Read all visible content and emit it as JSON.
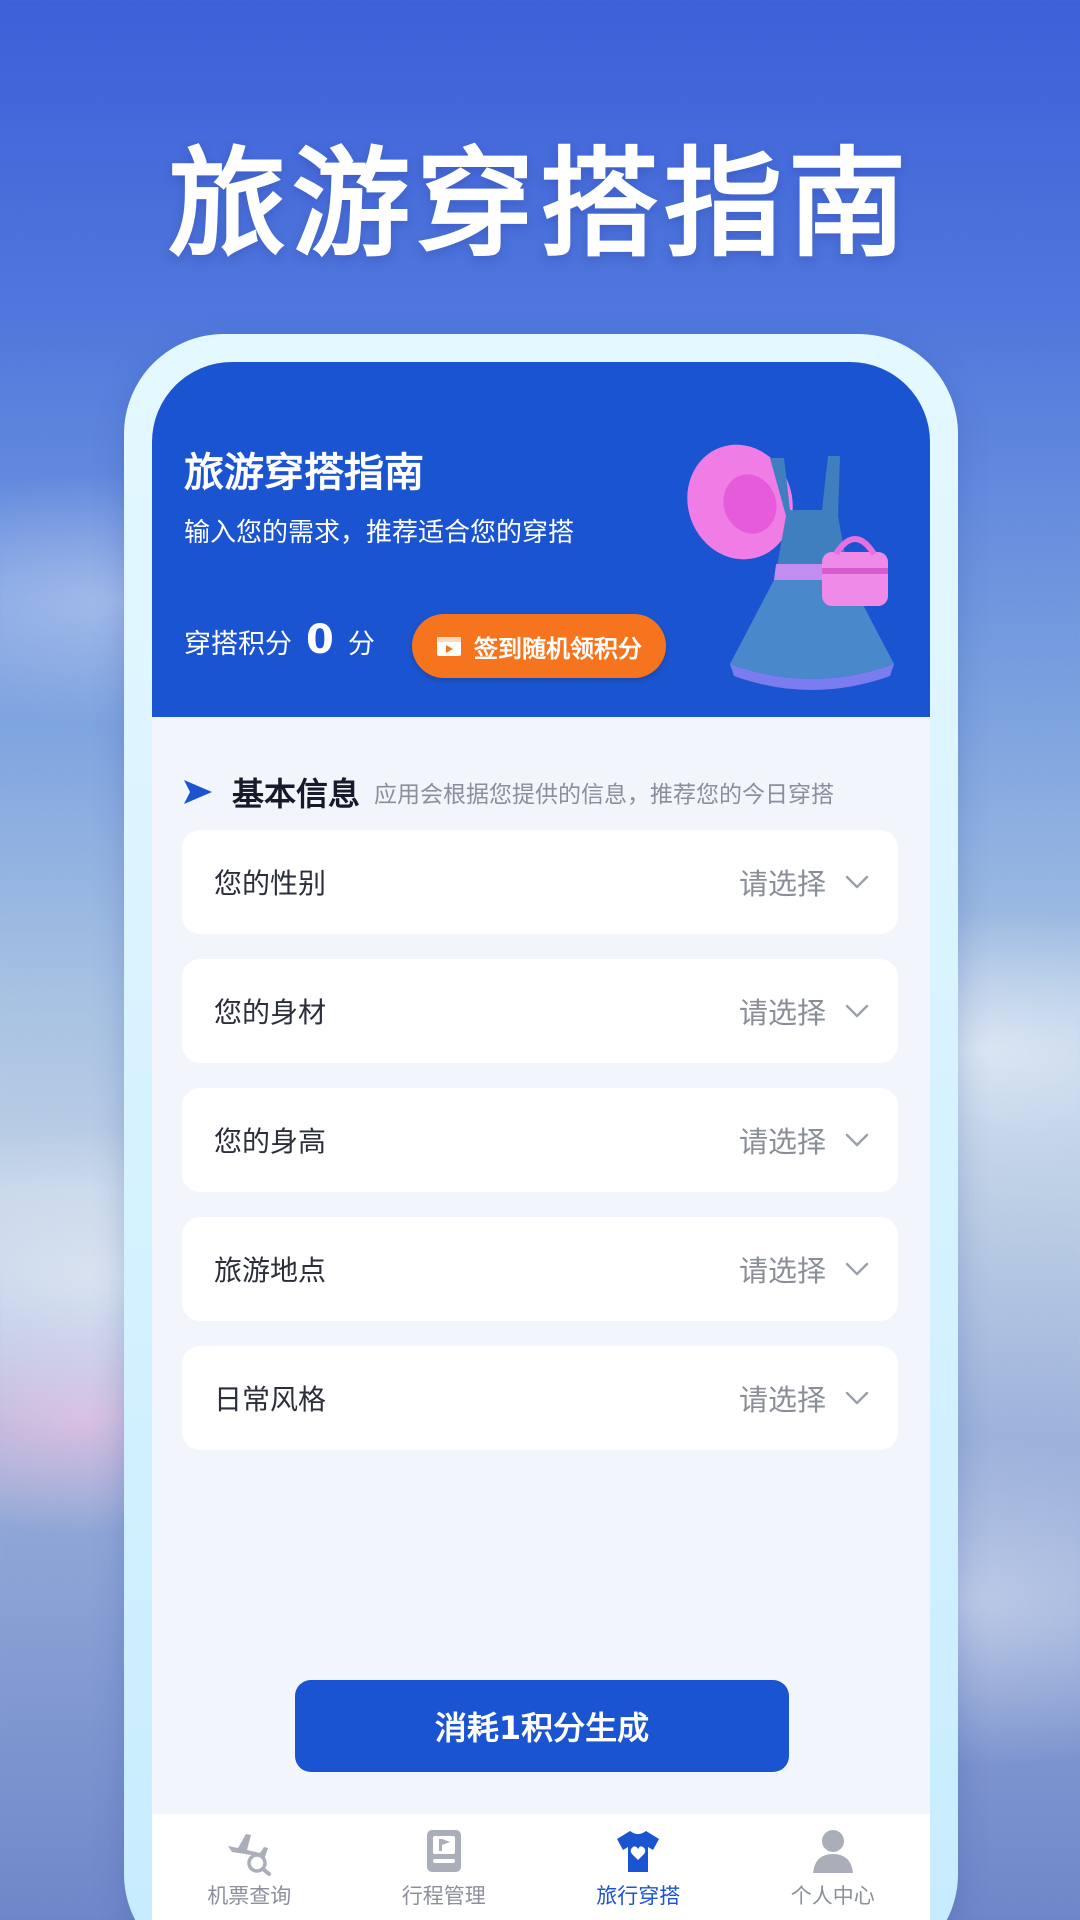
{
  "hero": {
    "title": "旅游穿搭指南"
  },
  "banner": {
    "title": "旅游穿搭指南",
    "subtitle": "输入您的需求，推荐适合您的穿搭",
    "points_label": "穿搭积分",
    "points_value": "0",
    "points_unit": "分",
    "checkin_label": "签到随机领积分"
  },
  "section": {
    "title": "基本信息",
    "description": "应用会根据您提供的信息，推荐您的今日穿搭"
  },
  "form": {
    "rows": [
      {
        "label": "您的性别",
        "value": "请选择"
      },
      {
        "label": "您的身材",
        "value": "请选择"
      },
      {
        "label": "您的身高",
        "value": "请选择"
      },
      {
        "label": "旅游地点",
        "value": "请选择"
      },
      {
        "label": "日常风格",
        "value": "请选择"
      }
    ]
  },
  "actions": {
    "generate_label": "消耗1积分生成"
  },
  "tabs": [
    {
      "label": "机票查询",
      "icon": "plane-search-icon",
      "active": false
    },
    {
      "label": "行程管理",
      "icon": "itinerary-icon",
      "active": false
    },
    {
      "label": "旅行穿搭",
      "icon": "tshirt-heart-icon",
      "active": true
    },
    {
      "label": "个人中心",
      "icon": "person-icon",
      "active": false
    }
  ],
  "colors": {
    "primary": "#1b54d0",
    "accent_orange": "#f6741d",
    "tab_inactive": "#8b909c"
  }
}
